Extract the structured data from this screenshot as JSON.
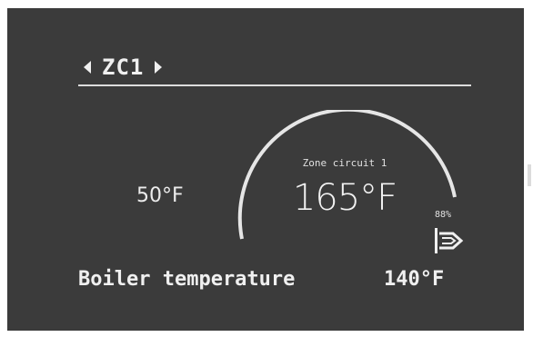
{
  "header": {
    "zone_title": "ZC1"
  },
  "gauge": {
    "circuit_label": "Zone circuit 1",
    "current_temp": "165°F",
    "min_temp": "50°F"
  },
  "burner": {
    "modulation": "88%",
    "icon": "burner-flame-icon"
  },
  "boiler": {
    "label": "Boiler temperature",
    "value": "140°F"
  },
  "colors": {
    "background": "#3b3b3b",
    "foreground": "#f0f0f0"
  }
}
